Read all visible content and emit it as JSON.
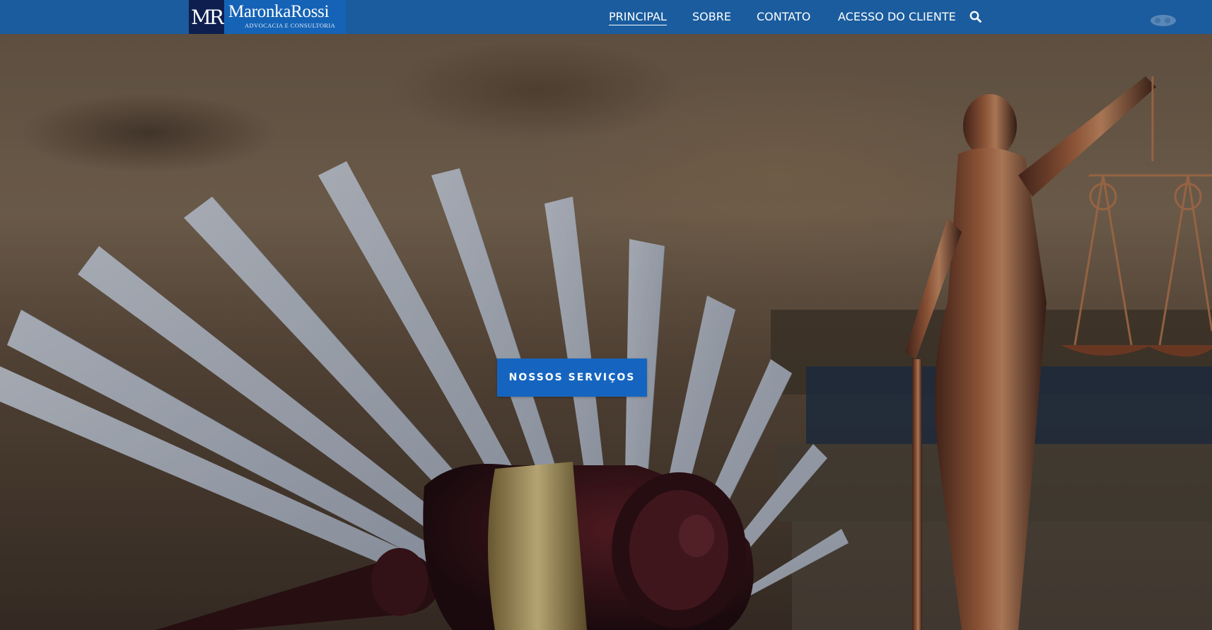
{
  "header": {
    "logo": {
      "mark": "MR",
      "name": "MaronkaRossi",
      "tagline": "ADVOCACIA E CONSULTORIA"
    },
    "nav": [
      {
        "label": "PRINCIPAL",
        "active": true
      },
      {
        "label": "SOBRE",
        "active": false
      },
      {
        "label": "CONTATO",
        "active": false
      },
      {
        "label": "ACESSO DO CLIENTE",
        "active": false
      }
    ],
    "search_icon": "search-icon"
  },
  "hero": {
    "cta_label": "NOSSOS SERVIÇOS",
    "image_description_icon": "gavel-book-scales-photo"
  },
  "colors": {
    "header_bg": "#1a5c9e",
    "logo_mark_bg": "#0e1f4f",
    "logo_text_bg": "#1563b6",
    "cta_bg": "#1565c0"
  }
}
